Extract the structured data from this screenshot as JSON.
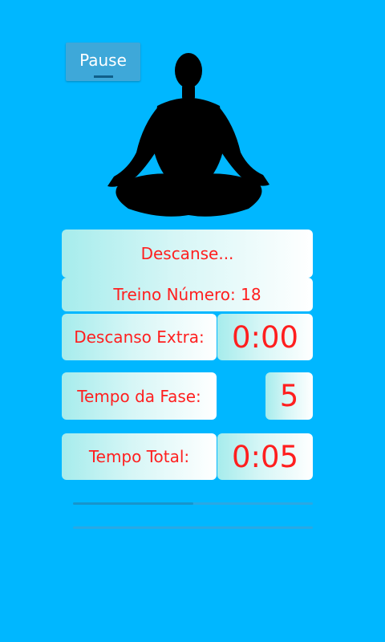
{
  "toolbar": {
    "pause_label": "Pause"
  },
  "status": {
    "message": "Descanse...",
    "treino": "Treino Número: 18"
  },
  "stats": {
    "descanso_extra": {
      "label": "Descanso Extra:",
      "value": "0:00"
    },
    "tempo_fase": {
      "label": "Tempo da Fase:",
      "value": "5"
    },
    "tempo_total": {
      "label": "Tempo Total:",
      "value": "0:05"
    }
  },
  "colors": {
    "background": "#00b7ff",
    "text_accent": "#ff1f1f",
    "button": "#3ea8d9"
  },
  "icons": {
    "meditation": "meditation-figure-icon"
  },
  "progress": {
    "phase_fraction": 0.5,
    "total_fraction": 0.0
  }
}
